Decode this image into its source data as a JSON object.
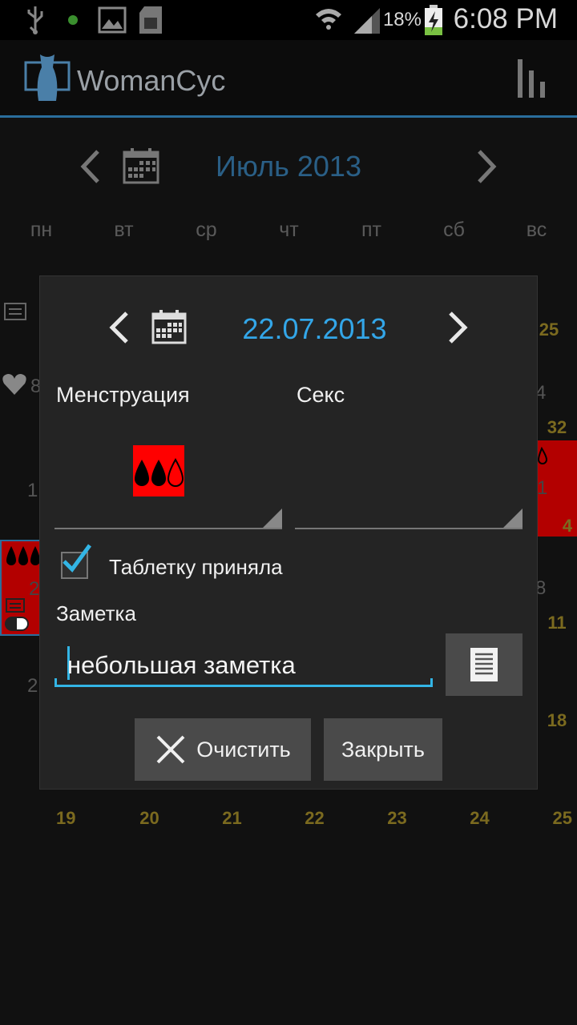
{
  "status_bar": {
    "battery_percent": "18%",
    "time": "6:08 PM",
    "icons": [
      "usb-icon",
      "notification-dot-icon",
      "image-icon",
      "sd-card-icon",
      "wifi-icon",
      "signal-icon",
      "battery-charging-icon"
    ]
  },
  "app": {
    "title": "WomanCyc",
    "icons": {
      "logo": "dress-logo-icon",
      "menu": "stats-bars-icon"
    }
  },
  "calendar": {
    "month_title": "Июль 2013",
    "weekdays": [
      "пн",
      "вт",
      "ср",
      "чт",
      "пт",
      "сб",
      "вс"
    ],
    "visible_right_column_numbers": [
      "25",
      "32",
      "4",
      "11",
      "18"
    ],
    "partial_numbers": {
      "left": [
        "1",
        "8",
        "1",
        "2",
        "2"
      ],
      "right": [
        "4",
        "1",
        "8"
      ]
    },
    "bottom_row": [
      "19",
      "20",
      "21",
      "22",
      "23",
      "24",
      "25"
    ]
  },
  "dialog": {
    "date": "22.07.2013",
    "menstruation_label": "Менструация",
    "sex_label": "Секс",
    "pill_label": "Таблетку приняла",
    "pill_checked": true,
    "note_label": "Заметка",
    "note_value": "небольшая заметка",
    "clear_button": "Очистить",
    "close_button": "Закрыть",
    "colors": {
      "accent": "#33a6e8",
      "flow_bg": "#ff0000"
    }
  }
}
